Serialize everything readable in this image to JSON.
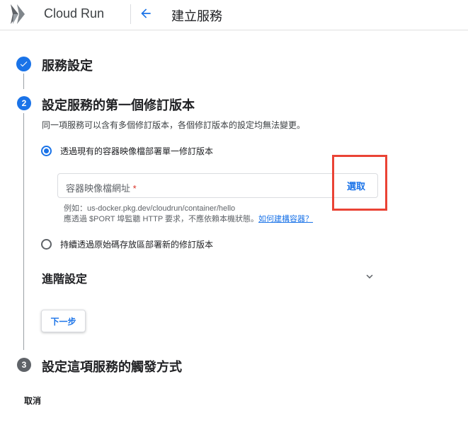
{
  "header": {
    "app_title": "Cloud Run",
    "page_title": "建立服務"
  },
  "steps": [
    {
      "number": "1",
      "title": "服務設定",
      "state": "complete"
    },
    {
      "number": "2",
      "title": "設定服務的第一個修訂版本",
      "state": "active"
    },
    {
      "number": "3",
      "title": "設定這項服務的觸發方式",
      "state": "inactive"
    }
  ],
  "revision": {
    "description": "同一項服務可以含有多個修訂版本，各個修訂版本的設定均無法變更。",
    "option_existing": "透過現有的容器映像檔部署單一修訂版本",
    "option_source": "持續透過原始碼存放區部署新的修訂版本",
    "selected_option": "existing",
    "url_field": {
      "placeholder": "容器映像檔網址",
      "required_mark": "*",
      "value": ""
    },
    "select_label": "選取",
    "hint_example": "例如：us-docker.pkg.dev/cloudrun/container/hello",
    "hint_line2": "應透過 $PORT 埠監聽 HTTP 要求，不應依賴本機狀態。",
    "hint_link": "如何建構容器？"
  },
  "advanced": {
    "label": "進階設定",
    "expanded": false
  },
  "buttons": {
    "next": "下一步",
    "cancel": "取消"
  },
  "colors": {
    "accent": "#1a73e8",
    "highlight": "#ea4335",
    "inactive_step": "#5f6368"
  }
}
